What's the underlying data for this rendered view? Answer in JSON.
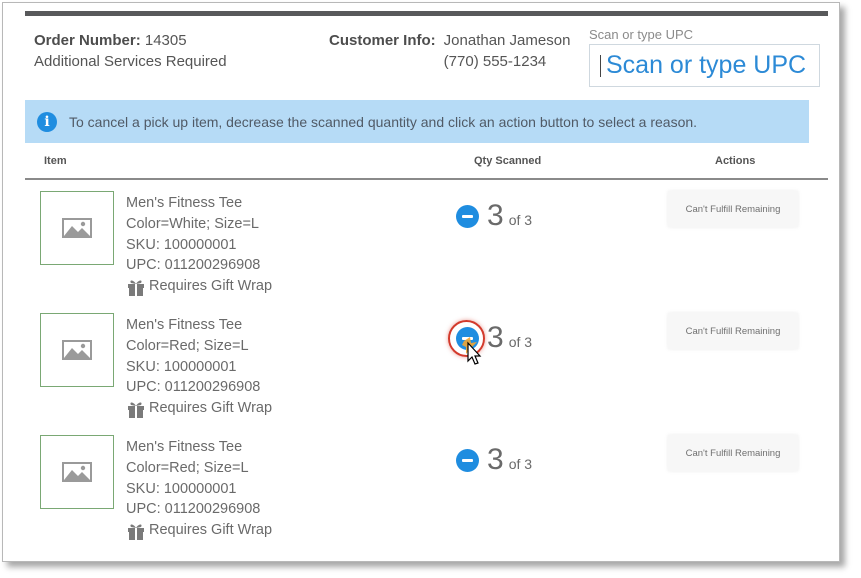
{
  "order": {
    "label": "Order Number:",
    "number": "14305",
    "note": "Additional Services Required"
  },
  "customer": {
    "label": "Customer Info:",
    "name": "Jonathan Jameson",
    "phone": "(770) 555-1234"
  },
  "scan": {
    "label": "Scan or type UPC",
    "placeholder": "Scan or type UPC"
  },
  "banner": {
    "icon": "info-icon",
    "text": "To cancel a pick up item, decrease the scanned quantity and click an action button to select a reason."
  },
  "table": {
    "headers": {
      "item": "Item",
      "qty": "Qty Scanned",
      "actions": "Actions"
    },
    "rows": [
      {
        "name": "Men's Fitness Tee",
        "attrs": "Color=White; Size=L",
        "sku": "SKU: 100000001",
        "upc": "UPC: 011200296908",
        "gift": "Requires Gift Wrap",
        "qty": "3",
        "of": "of 3",
        "action": "Can't Fulfill Remaining"
      },
      {
        "name": "Men's Fitness Tee",
        "attrs": "Color=Red; Size=L",
        "sku": "SKU: 100000001",
        "upc": "UPC: 011200296908",
        "gift": "Requires Gift Wrap",
        "qty": "3",
        "of": "of 3",
        "action": "Can't Fulfill Remaining"
      },
      {
        "name": "Men's Fitness Tee",
        "attrs": "Color=Red; Size=L",
        "sku": "SKU: 100000001",
        "upc": "UPC: 011200296908",
        "gift": "Requires Gift Wrap",
        "qty": "3",
        "of": "of 3",
        "action": "Can't Fulfill Remaining"
      }
    ]
  },
  "colors": {
    "accent": "#1f8de0",
    "banner_bg": "#b6dbf6",
    "upc_text": "#2c8ad6",
    "click_highlight": "#d33a2c"
  }
}
